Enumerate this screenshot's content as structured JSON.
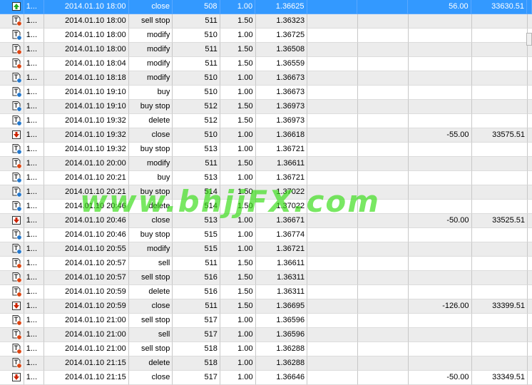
{
  "rows": [
    {
      "num": "1...",
      "time": "2014.01.10 18:00",
      "type": "close",
      "order": "508",
      "volume": "1.00",
      "price": "1.36625",
      "profit": "56.00",
      "balance": "33630.51",
      "icon": "balance-up-icon",
      "selected": true
    },
    {
      "num": "1...",
      "time": "2014.01.10 18:00",
      "type": "sell stop",
      "order": "511",
      "volume": "1.50",
      "price": "1.36323",
      "profit": "",
      "balance": "",
      "icon": "doc-sell-icon"
    },
    {
      "num": "1...",
      "time": "2014.01.10 18:00",
      "type": "modify",
      "order": "510",
      "volume": "1.00",
      "price": "1.36725",
      "profit": "",
      "balance": "",
      "icon": "doc-buy-icon"
    },
    {
      "num": "1...",
      "time": "2014.01.10 18:00",
      "type": "modify",
      "order": "511",
      "volume": "1.50",
      "price": "1.36508",
      "profit": "",
      "balance": "",
      "icon": "doc-sell-icon"
    },
    {
      "num": "1...",
      "time": "2014.01.10 18:04",
      "type": "modify",
      "order": "511",
      "volume": "1.50",
      "price": "1.36559",
      "profit": "",
      "balance": "",
      "icon": "doc-sell-icon"
    },
    {
      "num": "1...",
      "time": "2014.01.10 18:18",
      "type": "modify",
      "order": "510",
      "volume": "1.00",
      "price": "1.36673",
      "profit": "",
      "balance": "",
      "icon": "doc-buy-icon"
    },
    {
      "num": "1...",
      "time": "2014.01.10 19:10",
      "type": "buy",
      "order": "510",
      "volume": "1.00",
      "price": "1.36673",
      "profit": "",
      "balance": "",
      "icon": "doc-buy-icon"
    },
    {
      "num": "1...",
      "time": "2014.01.10 19:10",
      "type": "buy stop",
      "order": "512",
      "volume": "1.50",
      "price": "1.36973",
      "profit": "",
      "balance": "",
      "icon": "doc-buy-icon"
    },
    {
      "num": "1...",
      "time": "2014.01.10 19:32",
      "type": "delete",
      "order": "512",
      "volume": "1.50",
      "price": "1.36973",
      "profit": "",
      "balance": "",
      "icon": "doc-buy-icon"
    },
    {
      "num": "1...",
      "time": "2014.01.10 19:32",
      "type": "close",
      "order": "510",
      "volume": "1.00",
      "price": "1.36618",
      "profit": "-55.00",
      "balance": "33575.51",
      "icon": "balance-down-icon"
    },
    {
      "num": "1...",
      "time": "2014.01.10 19:32",
      "type": "buy stop",
      "order": "513",
      "volume": "1.00",
      "price": "1.36721",
      "profit": "",
      "balance": "",
      "icon": "doc-buy-icon"
    },
    {
      "num": "1...",
      "time": "2014.01.10 20:00",
      "type": "modify",
      "order": "511",
      "volume": "1.50",
      "price": "1.36611",
      "profit": "",
      "balance": "",
      "icon": "doc-sell-icon"
    },
    {
      "num": "1...",
      "time": "2014.01.10 20:21",
      "type": "buy",
      "order": "513",
      "volume": "1.00",
      "price": "1.36721",
      "profit": "",
      "balance": "",
      "icon": "doc-buy-icon"
    },
    {
      "num": "1...",
      "time": "2014.01.10 20:21",
      "type": "buy stop",
      "order": "514",
      "volume": "1.50",
      "price": "1.37022",
      "profit": "",
      "balance": "",
      "icon": "doc-buy-icon"
    },
    {
      "num": "1...",
      "time": "2014.01.10 20:46",
      "type": "delete",
      "order": "514",
      "volume": "1.50",
      "price": "1.37022",
      "profit": "",
      "balance": "",
      "icon": "doc-buy-icon"
    },
    {
      "num": "1...",
      "time": "2014.01.10 20:46",
      "type": "close",
      "order": "513",
      "volume": "1.00",
      "price": "1.36671",
      "profit": "-50.00",
      "balance": "33525.51",
      "icon": "balance-down-icon"
    },
    {
      "num": "1...",
      "time": "2014.01.10 20:46",
      "type": "buy stop",
      "order": "515",
      "volume": "1.00",
      "price": "1.36774",
      "profit": "",
      "balance": "",
      "icon": "doc-buy-icon"
    },
    {
      "num": "1...",
      "time": "2014.01.10 20:55",
      "type": "modify",
      "order": "515",
      "volume": "1.00",
      "price": "1.36721",
      "profit": "",
      "balance": "",
      "icon": "doc-buy-icon"
    },
    {
      "num": "1...",
      "time": "2014.01.10 20:57",
      "type": "sell",
      "order": "511",
      "volume": "1.50",
      "price": "1.36611",
      "profit": "",
      "balance": "",
      "icon": "doc-sell-icon"
    },
    {
      "num": "1...",
      "time": "2014.01.10 20:57",
      "type": "sell stop",
      "order": "516",
      "volume": "1.50",
      "price": "1.36311",
      "profit": "",
      "balance": "",
      "icon": "doc-sell-icon"
    },
    {
      "num": "1...",
      "time": "2014.01.10 20:59",
      "type": "delete",
      "order": "516",
      "volume": "1.50",
      "price": "1.36311",
      "profit": "",
      "balance": "",
      "icon": "doc-sell-icon"
    },
    {
      "num": "1...",
      "time": "2014.01.10 20:59",
      "type": "close",
      "order": "511",
      "volume": "1.50",
      "price": "1.36695",
      "profit": "-126.00",
      "balance": "33399.51",
      "icon": "balance-down-icon"
    },
    {
      "num": "1...",
      "time": "2014.01.10 21:00",
      "type": "sell stop",
      "order": "517",
      "volume": "1.00",
      "price": "1.36596",
      "profit": "",
      "balance": "",
      "icon": "doc-sell-icon"
    },
    {
      "num": "1...",
      "time": "2014.01.10 21:00",
      "type": "sell",
      "order": "517",
      "volume": "1.00",
      "price": "1.36596",
      "profit": "",
      "balance": "",
      "icon": "doc-sell-icon"
    },
    {
      "num": "1...",
      "time": "2014.01.10 21:00",
      "type": "sell stop",
      "order": "518",
      "volume": "1.00",
      "price": "1.36288",
      "profit": "",
      "balance": "",
      "icon": "doc-sell-icon"
    },
    {
      "num": "1...",
      "time": "2014.01.10 21:15",
      "type": "delete",
      "order": "518",
      "volume": "1.00",
      "price": "1.36288",
      "profit": "",
      "balance": "",
      "icon": "doc-sell-icon"
    },
    {
      "num": "1...",
      "time": "2014.01.10 21:15",
      "type": "close",
      "order": "517",
      "volume": "1.00",
      "price": "1.36646",
      "profit": "-50.00",
      "balance": "33349.51",
      "icon": "balance-down-icon"
    }
  ],
  "watermark": "www.bhjjFX.com",
  "colors": {
    "selected_row": "#3399ff",
    "stripe": "#ececec",
    "buy_dot": "#2277cc",
    "sell_dot": "#dd4411",
    "up_arrow": "#22aa22",
    "down_arrow": "#cc2200",
    "watermark": "#33dd11"
  }
}
